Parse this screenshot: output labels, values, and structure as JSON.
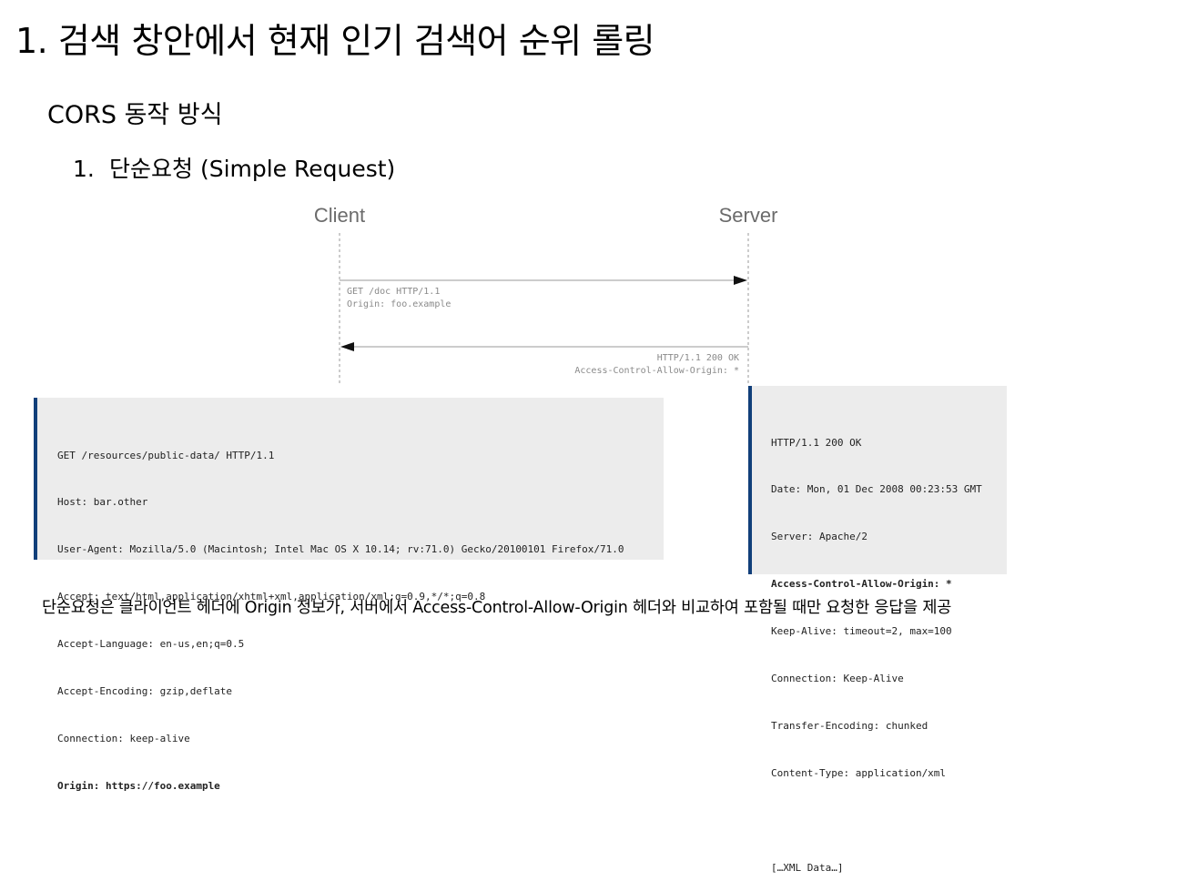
{
  "title": "1. 검색 창안에서 현재 인기 검색어 순위 롤링",
  "section": {
    "heading": "CORS 동작 방식"
  },
  "list_item": {
    "number": "1.",
    "label": "단순요청 (Simple Request)"
  },
  "diagram": {
    "client_label": "Client",
    "server_label": "Server",
    "request_lines": [
      "GET /doc HTTP/1.1",
      "Origin: foo.example"
    ],
    "response_lines": [
      "HTTP/1.1 200 OK",
      "Access-Control-Allow-Origin: *"
    ]
  },
  "request_code": {
    "lines": [
      "GET /resources/public-data/ HTTP/1.1",
      "Host: bar.other",
      "User-Agent: Mozilla/5.0 (Macintosh; Intel Mac OS X 10.14; rv:71.0) Gecko/20100101 Firefox/71.0",
      "Accept: text/html,application/xhtml+xml,application/xml;q=0.9,*/*;q=0.8",
      "Accept-Language: en-us,en;q=0.5",
      "Accept-Encoding: gzip,deflate",
      "Connection: keep-alive",
      "Origin: https://foo.example"
    ]
  },
  "response_code": {
    "lines": [
      "HTTP/1.1 200 OK",
      "Date: Mon, 01 Dec 2008 00:23:53 GMT",
      "Server: Apache/2",
      "Access-Control-Allow-Origin: *",
      "Keep-Alive: timeout=2, max=100",
      "Connection: Keep-Alive",
      "Transfer-Encoding: chunked",
      "Content-Type: application/xml",
      "",
      "[…XML Data…]"
    ]
  },
  "caption": "단순요청은 클라이언트 헤더에 Origin 정보가, 서버에서 Access-Control-Allow-Origin 헤더와 비교하여 포함될 때만 요청한 응답을 제공",
  "colors": {
    "code_bg": "#ececec",
    "code_border": "#113f7a",
    "actor_text": "#6b6b6b"
  }
}
